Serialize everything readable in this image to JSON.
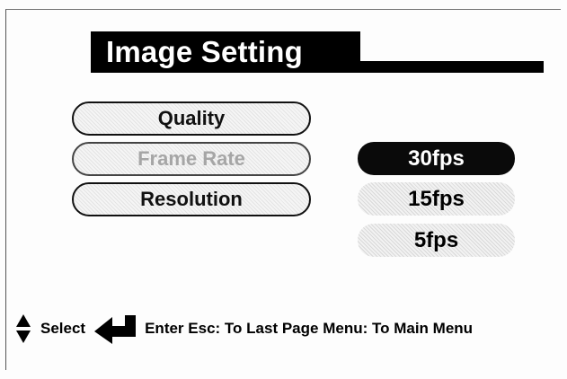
{
  "title": "Image Setting",
  "menu": [
    {
      "label": "Quality",
      "state": "normal"
    },
    {
      "label": "Frame Rate",
      "state": "active-disabled"
    },
    {
      "label": "Resolution",
      "state": "normal"
    }
  ],
  "options": [
    {
      "label": "30fps",
      "selected": true
    },
    {
      "label": "15fps",
      "selected": false
    },
    {
      "label": "5fps",
      "selected": false
    }
  ],
  "footer": {
    "select_label": "Select",
    "enter_label": "Enter",
    "esc_hint": "Esc: To Last Page",
    "menu_hint": "Menu: To Main Menu",
    "icons": [
      "up-down-arrow-icon",
      "enter-arrow-icon"
    ]
  },
  "colors": {
    "highlight": "#000000",
    "disabled_text": "#a6a6a6",
    "background": "#fdfdfd"
  }
}
